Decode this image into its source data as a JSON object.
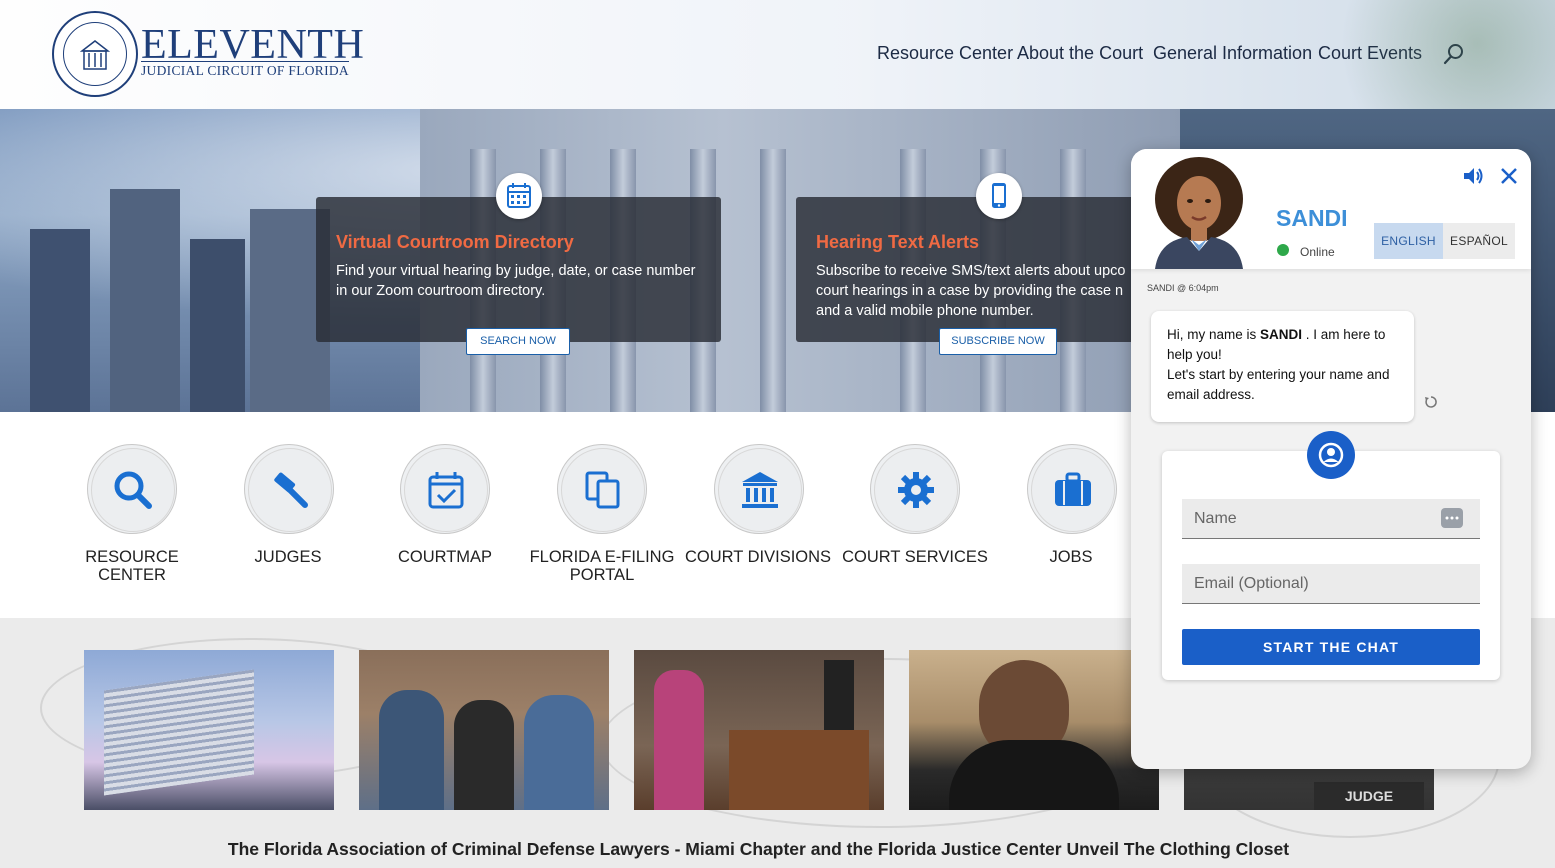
{
  "site": {
    "logo_title": "ELEVENTH",
    "logo_subtitle": "JUDICIAL CIRCUIT OF FLORIDA"
  },
  "nav": {
    "items": [
      "Resource Center",
      "About the Court",
      "General Information",
      "Court Events"
    ]
  },
  "hero_cards": [
    {
      "title": "Virtual Courtroom Directory",
      "text": "Find your virtual hearing by judge, date, or case number in our Zoom courtroom directory.",
      "button": "SEARCH NOW",
      "icon": "calendar-icon"
    },
    {
      "title": "Hearing Text Alerts",
      "text": "Subscribe to receive SMS/text alerts about upco court hearings in a case by providing the case n and a valid mobile phone number.",
      "button": "SUBSCRIBE NOW",
      "icon": "mobile-phone-icon"
    }
  ],
  "quick_links": [
    {
      "label": "RESOURCE CENTER",
      "icon": "search-icon"
    },
    {
      "label": "JUDGES",
      "icon": "gavel-icon"
    },
    {
      "label": "COURTMAP",
      "icon": "calendar-check-icon"
    },
    {
      "label": "FLORIDA E-FILING PORTAL",
      "icon": "documents-icon"
    },
    {
      "label": "COURT DIVISIONS",
      "icon": "courthouse-icon"
    },
    {
      "label": "COURT SERVICES",
      "icon": "gear-icon"
    },
    {
      "label": "JOBS",
      "icon": "briefcase-icon"
    }
  ],
  "news": {
    "headline": "The Florida Association of Criminal Defense Lawyers - Miami Chapter and the Florida Justice Center Unveil The Clothing Closet",
    "photo_caption_text": "JUDGE"
  },
  "chat": {
    "agent_name": "SANDI",
    "status": "Online",
    "lang_english": "ENGLISH",
    "lang_spanish": "ESPAÑOL",
    "message_meta": "SANDI @ 6:04pm",
    "message_line1_pre": "Hi, my name is ",
    "message_name": "SANDI",
    "message_line1_post": " . I am here to help you!",
    "message_line2": "Let's start by entering your name and email address.",
    "name_placeholder": "Name",
    "email_placeholder": "Email (Optional)",
    "start_button": "START THE CHAT"
  },
  "colors": {
    "brand_navy": "#1f3f7a",
    "accent_orange": "#f06a43",
    "icon_blue": "#1a6fd1",
    "chat_blue": "#1a5fc8",
    "online_green": "#2ea84a"
  }
}
